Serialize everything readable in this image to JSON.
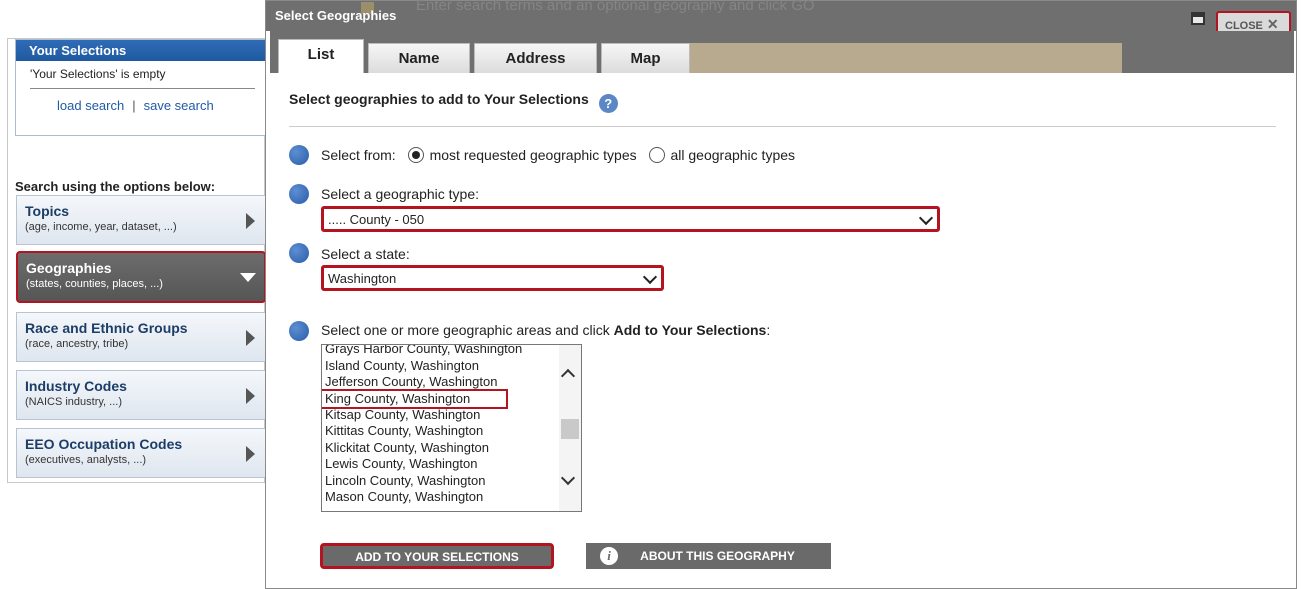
{
  "sidebar": {
    "your_selections": {
      "title": "Your Selections",
      "empty_text": "'Your Selections' is empty",
      "load_link": "load search",
      "separator": "|",
      "save_link": "save search"
    },
    "search_title": "Search using the options below:",
    "options": [
      {
        "title": "Topics",
        "subtitle": "(age, income, year, dataset, ...)",
        "active": false
      },
      {
        "title": "Geographies",
        "subtitle": "(states, counties, places, ...)",
        "active": true
      },
      {
        "title": "Race and Ethnic Groups",
        "subtitle": "(race, ancestry, tribe)",
        "active": false
      },
      {
        "title": "Industry Codes",
        "subtitle": "(NAICS industry, ...)",
        "active": false
      },
      {
        "title": "EEO Occupation Codes",
        "subtitle": "(executives, analysts, ...)",
        "active": false
      }
    ]
  },
  "dialog": {
    "background_hint": "Enter search terms and an optional geography and click GO",
    "title": "Select Geographies",
    "close_label": "CLOSE",
    "close_glyph": "✕",
    "tabs": [
      {
        "label": "List",
        "active": true
      },
      {
        "label": "Name",
        "active": false
      },
      {
        "label": "Address",
        "active": false
      },
      {
        "label": "Map",
        "active": false
      }
    ],
    "heading": "Select geographies to add to Your Selections",
    "help_glyph": "?",
    "select_from": {
      "label": "Select from:",
      "option_1": "most requested geographic types",
      "option_2": "all geographic types",
      "selected": "most requested geographic types"
    },
    "geo_type": {
      "label": "Select a geographic type:",
      "value": "..... County - 050"
    },
    "state": {
      "label": "Select a state:",
      "value": "Washington"
    },
    "areas": {
      "label_prefix": "Select one or more geographic areas and click ",
      "label_bold": "Add to Your Selections",
      "label_suffix": ":",
      "items": [
        "Grays Harbor County, Washington",
        "Island County, Washington",
        "Jefferson County, Washington",
        "King County, Washington",
        "Kitsap County, Washington",
        "Kittitas County, Washington",
        "Klickitat County, Washington",
        "Lewis County, Washington",
        "Lincoln County, Washington",
        "Mason County, Washington"
      ],
      "selected": "King County, Washington"
    },
    "add_button": "ADD TO YOUR SELECTIONS",
    "about_button": "ABOUT THIS GEOGRAPHY"
  }
}
